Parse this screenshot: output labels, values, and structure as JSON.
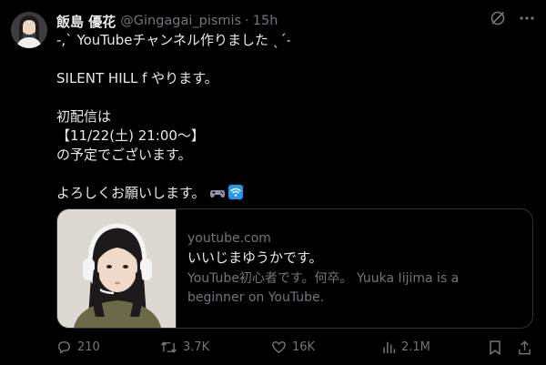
{
  "tweet": {
    "author_name": "飯島 優花",
    "handle": "@Gingagai_pismis",
    "separator": "·",
    "time": "15h",
    "lines": [
      "-,` YouTubeチャンネル作りました ˎˊ˗",
      "",
      "SILENT HILL f やります。",
      "",
      "初配信は",
      "【11/22(土) 21:00〜】",
      "の予定でございます。",
      "",
      "よろしくお願いします。"
    ]
  },
  "card": {
    "domain": "youtube.com",
    "title": "いいじまゆうかです。",
    "description_line1": "YouTube初心者です。何卒。 Yuuka Iijima is a",
    "description_line2": "beginner on YouTube."
  },
  "actions": {
    "replies": "210",
    "reposts": "3.7K",
    "likes": "16K",
    "views": "2.1M"
  },
  "icons": [
    "avatar",
    "grok-icon",
    "more-icon",
    "controller-emoji",
    "wifi-emoji",
    "reply-icon",
    "repost-icon",
    "like-icon",
    "views-icon",
    "bookmark-icon",
    "share-icon"
  ],
  "colors": {
    "background": "#000000",
    "text": "#e7e9ea",
    "muted": "#71767b",
    "border": "#2f3336"
  }
}
